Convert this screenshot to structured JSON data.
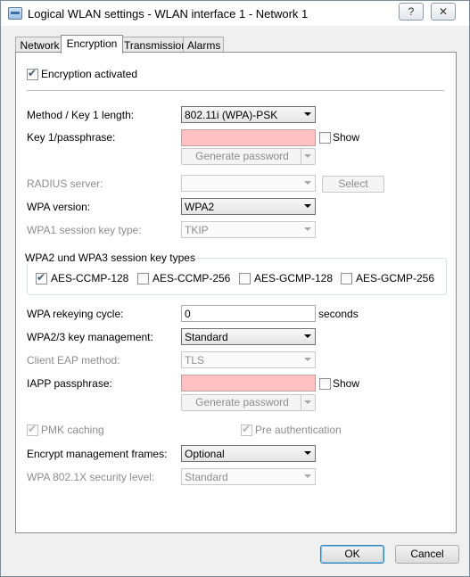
{
  "window": {
    "title": "Logical WLAN settings - WLAN interface 1 - Network 1",
    "help_label": "?",
    "close_label": "✕"
  },
  "tabs": [
    {
      "label": "Network"
    },
    {
      "label": "Encryption"
    },
    {
      "label": "Transmission"
    },
    {
      "label": "Alarms"
    }
  ],
  "active_tab": "Encryption",
  "form": {
    "encryption_activated": {
      "label": "Encryption activated",
      "checked": true
    },
    "method": {
      "label": "Method / Key 1 length:",
      "value": "802.11i (WPA)-PSK"
    },
    "key1": {
      "label": "Key 1/passphrase:",
      "value": "",
      "show_label": "Show",
      "show_checked": false
    },
    "generate_password_1": "Generate password",
    "radius": {
      "label": "RADIUS server:",
      "value": "",
      "select_label": "Select"
    },
    "wpa_version": {
      "label": "WPA version:",
      "value": "WPA2"
    },
    "wpa1_session": {
      "label": "WPA1 session key type:",
      "value": "TKIP"
    },
    "group": {
      "title": "WPA2 und WPA3 session key types",
      "items": [
        {
          "label": "AES-CCMP-128",
          "checked": true
        },
        {
          "label": "AES-CCMP-256",
          "checked": false
        },
        {
          "label": "AES-GCMP-128",
          "checked": false
        },
        {
          "label": "AES-GCMP-256",
          "checked": false
        }
      ]
    },
    "rekeying": {
      "label": "WPA rekeying cycle:",
      "value": "0",
      "unit": "seconds"
    },
    "key_mgmt": {
      "label": "WPA2/3 key management:",
      "value": "Standard"
    },
    "client_eap": {
      "label": "Client EAP method:",
      "value": "TLS"
    },
    "iapp": {
      "label": "IAPP passphrase:",
      "value": "",
      "show_label": "Show",
      "show_checked": false
    },
    "generate_password_2": "Generate password",
    "pmk_caching": {
      "label": "PMK caching",
      "checked": true
    },
    "pre_auth": {
      "label": "Pre authentication",
      "checked": true
    },
    "encrypt_mgmt": {
      "label": "Encrypt management frames:",
      "value": "Optional"
    },
    "wpa_8021x": {
      "label": "WPA 802.1X security level:",
      "value": "Standard"
    }
  },
  "footer": {
    "ok_label": "OK",
    "cancel_label": "Cancel"
  },
  "colors": {
    "invalid_field": "#ffc1c1",
    "default_button_border": "#3c7fb1"
  }
}
